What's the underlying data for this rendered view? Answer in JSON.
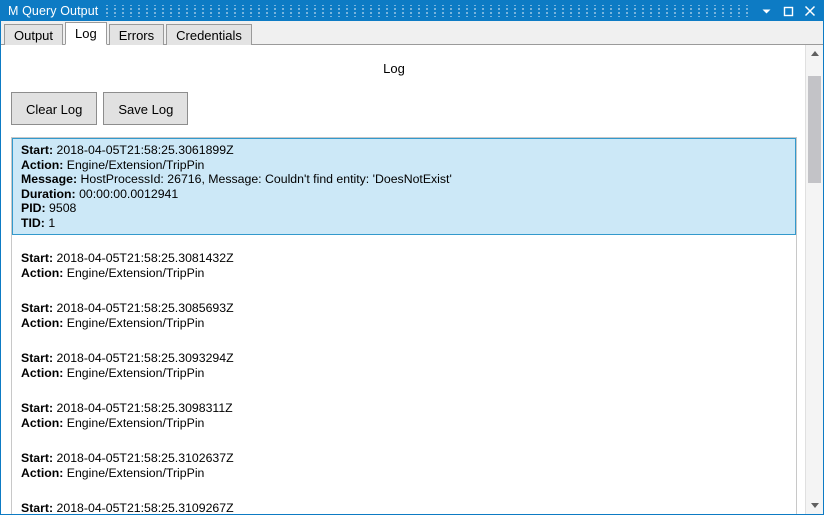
{
  "window": {
    "title": "M Query Output",
    "accent_color": "#0d7bc4",
    "controls": [
      {
        "name": "minimize",
        "glyph": "▼"
      },
      {
        "name": "maximize",
        "glyph": "□"
      },
      {
        "name": "close",
        "glyph": "✕"
      }
    ]
  },
  "tabs": [
    {
      "label": "Output",
      "selected": false
    },
    {
      "label": "Log",
      "selected": true
    },
    {
      "label": "Errors",
      "selected": false
    },
    {
      "label": "Credentials",
      "selected": false
    }
  ],
  "page": {
    "heading": "Log"
  },
  "toolbar": {
    "clear_log_label": "Clear Log",
    "save_log_label": "Save Log"
  },
  "labels": {
    "start": "Start:",
    "action": "Action:",
    "message": "Message:",
    "duration": "Duration:",
    "pid": "PID:",
    "tid": "TID:"
  },
  "selection": {
    "background_color": "#cce8f7",
    "border_color": "#3399cc"
  },
  "log_entries": [
    {
      "selected": true,
      "start": "2018-04-05T21:58:25.3061899Z",
      "action": "Engine/Extension/TripPin",
      "message": "HostProcessId: 26716, Message: Couldn't find entity: 'DoesNotExist'",
      "duration": "00:00:00.0012941",
      "pid": "9508",
      "tid": "1"
    },
    {
      "selected": false,
      "start": "2018-04-05T21:58:25.3081432Z",
      "action": "Engine/Extension/TripPin"
    },
    {
      "selected": false,
      "start": "2018-04-05T21:58:25.3085693Z",
      "action": "Engine/Extension/TripPin"
    },
    {
      "selected": false,
      "start": "2018-04-05T21:58:25.3093294Z",
      "action": "Engine/Extension/TripPin"
    },
    {
      "selected": false,
      "start": "2018-04-05T21:58:25.3098311Z",
      "action": "Engine/Extension/TripPin"
    },
    {
      "selected": false,
      "start": "2018-04-05T21:58:25.3102637Z",
      "action": "Engine/Extension/TripPin"
    },
    {
      "selected": false,
      "start": "2018-04-05T21:58:25.3109267Z"
    }
  ]
}
